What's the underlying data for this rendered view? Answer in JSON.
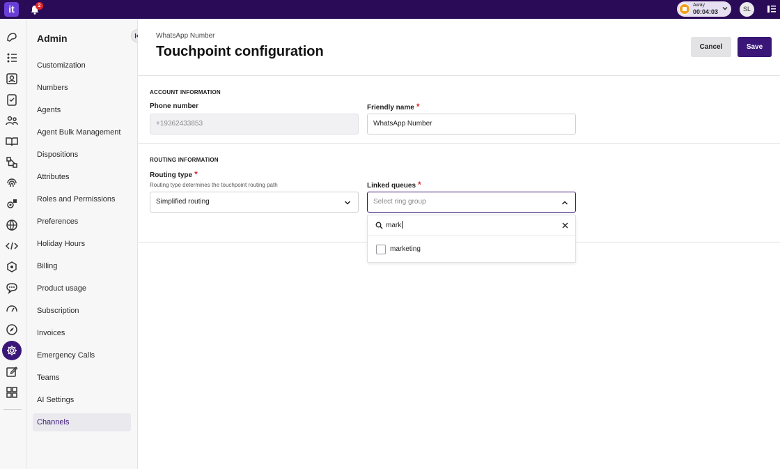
{
  "topbar": {
    "logo": "it",
    "notifications_count": "2",
    "status_label": "Away",
    "status_timer": "00:04:03",
    "avatar_initials": "SL"
  },
  "rail": {
    "icons": [
      "conversations-icon",
      "list-icon",
      "contacts-icon",
      "tasks-icon",
      "agents-icon",
      "knowledge-icon",
      "flows-icon",
      "fingerprint-icon",
      "integrations-icon",
      "globe-icon",
      "code-icon",
      "ai-icon",
      "chat-bubble-icon",
      "dashboard-icon",
      "compass-icon",
      "settings-icon",
      "edit-icon",
      "apps-icon"
    ],
    "active": "settings-icon"
  },
  "sidebar": {
    "title": "Admin",
    "items": [
      {
        "label": "Customization"
      },
      {
        "label": "Numbers"
      },
      {
        "label": "Agents"
      },
      {
        "label": "Agent Bulk Management"
      },
      {
        "label": "Dispositions"
      },
      {
        "label": "Attributes"
      },
      {
        "label": "Roles and Permissions"
      },
      {
        "label": "Preferences"
      },
      {
        "label": "Holiday Hours"
      },
      {
        "label": "Billing"
      },
      {
        "label": "Product usage"
      },
      {
        "label": "Subscription"
      },
      {
        "label": "Invoices"
      },
      {
        "label": "Emergency Calls"
      },
      {
        "label": "Teams"
      },
      {
        "label": "AI Settings"
      },
      {
        "label": "Channels"
      }
    ],
    "active_item": "Channels"
  },
  "header": {
    "breadcrumb": "WhatsApp Number",
    "title": "Touchpoint configuration",
    "cancel_label": "Cancel",
    "save_label": "Save"
  },
  "account": {
    "section_title": "ACCOUNT INFORMATION",
    "phone_label": "Phone number",
    "phone_value": "+19362433853",
    "friendly_label": "Friendly name",
    "friendly_value": "WhatsApp Number",
    "required_mark": "*"
  },
  "routing": {
    "section_title": "ROUTING INFORMATION",
    "type_label": "Routing type",
    "type_hint": "Routing type determines the touchpoint routing path",
    "type_value": "Simplified routing",
    "queues_label": "Linked queues",
    "queues_placeholder": "Select ring group",
    "search_value": "mark",
    "options": [
      {
        "label": "marketing",
        "checked": false
      }
    ]
  },
  "colors": {
    "brand": "#2a0b57",
    "accent": "#3a1678",
    "required": "#d62b2b"
  }
}
